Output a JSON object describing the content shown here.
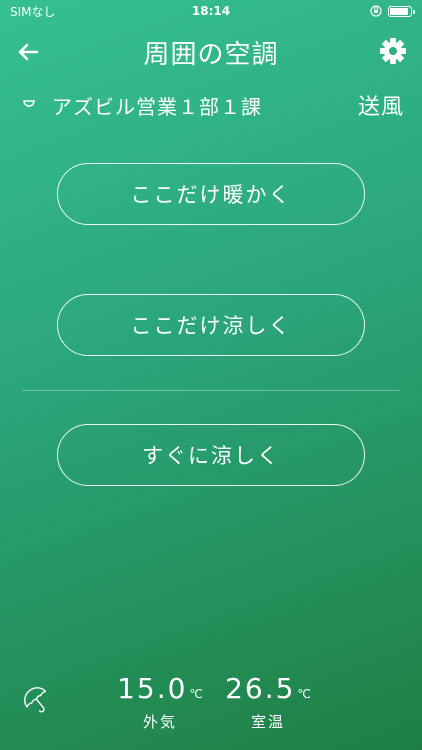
{
  "status_bar": {
    "carrier": "SIMなし",
    "time": "18:14"
  },
  "header": {
    "title": "周囲の空調",
    "back_icon": "arrow-left-icon",
    "settings_icon": "gear-icon"
  },
  "location": {
    "name": "アズビル営業１部１課",
    "mode": "送風"
  },
  "actions": {
    "warm": "ここだけ暖かく",
    "cool": "ここだけ涼しく",
    "quick_cool": "すぐに涼しく"
  },
  "temperatures": {
    "outdoor": {
      "value": "15.0",
      "unit": "℃",
      "label": "外気"
    },
    "indoor": {
      "value": "26.5",
      "unit": "℃",
      "label": "室温"
    }
  },
  "colors": {
    "gradient_start": "#36c08f",
    "gradient_end": "#1f7f43",
    "foreground": "#ffffff"
  }
}
